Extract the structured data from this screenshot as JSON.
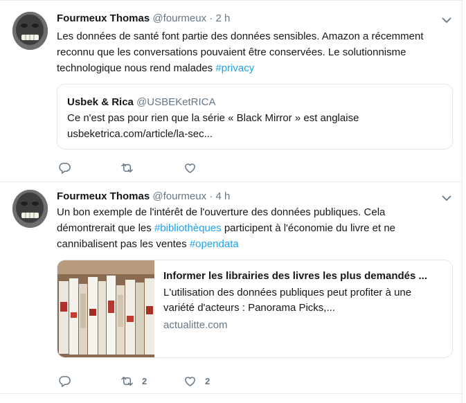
{
  "tweets": [
    {
      "author": "Fourmeux Thomas",
      "handle": "@fourmeux",
      "separator": "·",
      "time": "2 h",
      "lines": [
        "Les données de santé font partie des données sensibles. Amazon a récemment",
        "reconnu que les conversations pouvaient être conservées. Le solutionnisme"
      ],
      "line3_text": "technologique nous rend malades ",
      "line3_hashtag": "#privacy",
      "quote": {
        "name": "Usbek & Rica",
        "handle": "@USBEKetRICA",
        "text": "Ce n'est pas pour rien que la série « Black Mirror » est anglaise",
        "link": "usbeketrica.com/article/la-sec..."
      },
      "reply_count": "",
      "retweet_count": "",
      "like_count": ""
    },
    {
      "author": "Fourmeux Thomas",
      "handle": "@fourmeux",
      "separator": "·",
      "time": "4 h",
      "line1": "Un bon exemple de l'intérêt de l'ouverture des données publiques. Cela",
      "line2_pre": "démontrerait que les ",
      "line2_hashtag": "#bibliothèques",
      "line2_post": " participent à l'économie du livre et ne",
      "line3_pre": "cannibalisent pas les ventes ",
      "line3_hashtag": "#opendata",
      "card": {
        "title": "Informer les librairies des livres les plus demandés ...",
        "description": "L'utilisation des données publiques peut profiter à une variété d'acteurs : Panorama Picks,...",
        "domain": "actualitte.com"
      },
      "reply_count": "",
      "retweet_count": "2",
      "like_count": "2"
    }
  ],
  "icons": {
    "reply": "reply-icon",
    "retweet": "retweet-icon",
    "like": "heart-icon",
    "more": "chevron-down-icon"
  },
  "colors": {
    "hashtag": "#1da1f2",
    "secondary": "#657786",
    "border": "#e6ecf0"
  }
}
